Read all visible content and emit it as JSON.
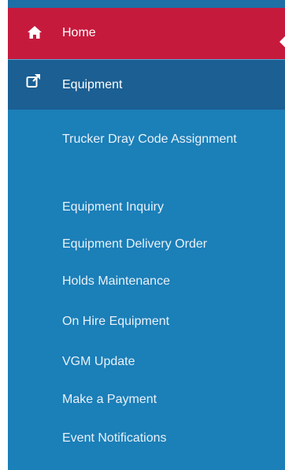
{
  "sidebar": {
    "home": {
      "label": "Home",
      "icon": "home-icon",
      "active": true
    },
    "equipment": {
      "label": "Equipment",
      "icon": "external-link-icon"
    },
    "submenu": [
      "Trucker Dray Code Assignment",
      "Equipment Inquiry",
      "Equipment Delivery Order",
      "Holds Maintenance",
      "On Hire Equipment",
      "VGM Update",
      "Make a Payment",
      "Event Notifications"
    ]
  },
  "colors": {
    "sidebar_bg": "#1b7fb8",
    "active_bg": "#c61a3d",
    "section_bg": "#1b5f93",
    "text": "#ffffff"
  }
}
